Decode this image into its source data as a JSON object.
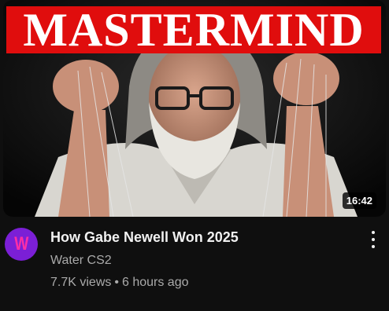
{
  "thumbnail": {
    "banner_text": "MASTERMIND",
    "duration": "16:42",
    "banner_color": "#e00d0d"
  },
  "channel": {
    "avatar_letter": "W",
    "avatar_color": "#7b1fd6",
    "name": "Water CS2"
  },
  "video": {
    "title": "How Gabe Newell Won 2025",
    "views": "7.7K views",
    "separator": "•",
    "age": "6 hours ago"
  },
  "icons": {
    "more": "more-vertical-icon"
  }
}
